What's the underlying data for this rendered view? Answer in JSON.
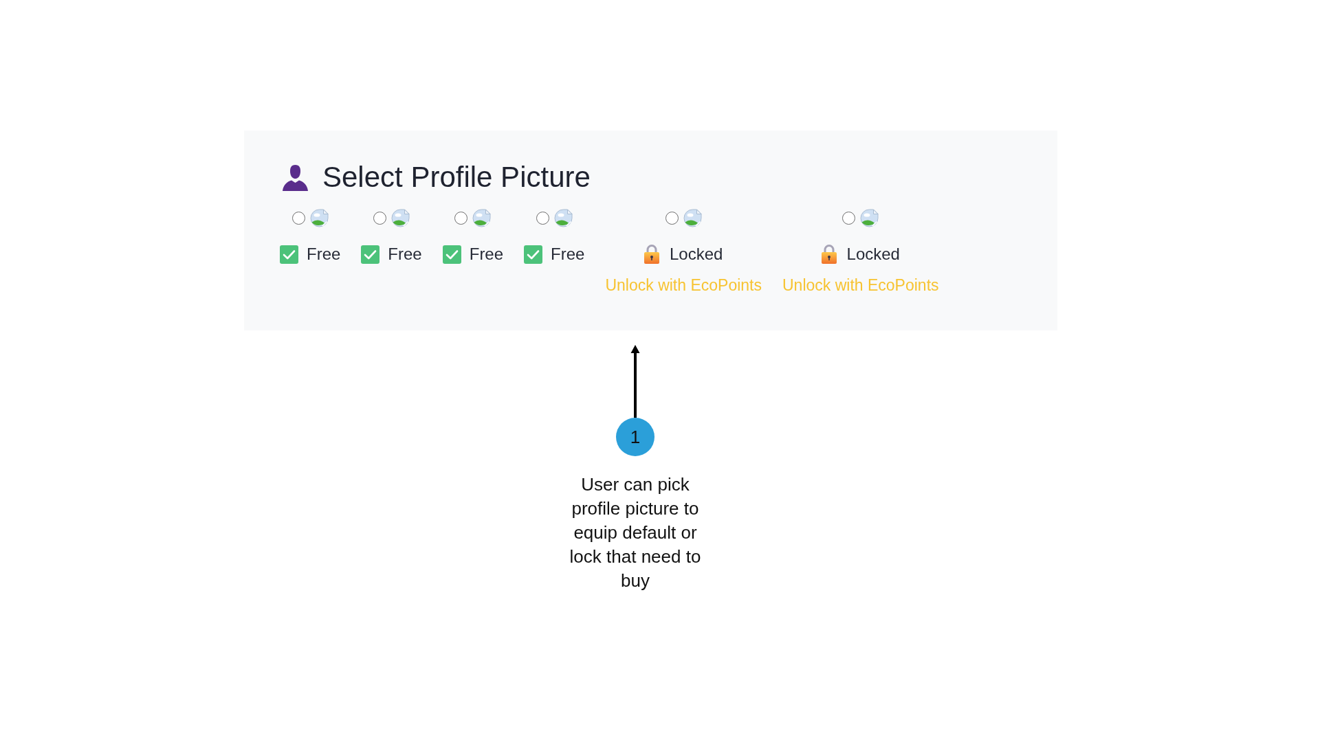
{
  "panel": {
    "title": "Select Profile Picture",
    "options": [
      {
        "kind": "free",
        "selected": false,
        "status": "Free"
      },
      {
        "kind": "free",
        "selected": false,
        "status": "Free"
      },
      {
        "kind": "free",
        "selected": false,
        "status": "Free"
      },
      {
        "kind": "free",
        "selected": false,
        "status": "Free"
      },
      {
        "kind": "locked",
        "selected": false,
        "status": "Locked",
        "unlock_link": "Unlock with EcoPoints"
      },
      {
        "kind": "locked",
        "selected": false,
        "status": "Locked",
        "unlock_link": "Unlock with EcoPoints"
      }
    ]
  },
  "annotation": {
    "number": "1",
    "text": "User can pick profile picture to equip default or lock that need to buy"
  }
}
